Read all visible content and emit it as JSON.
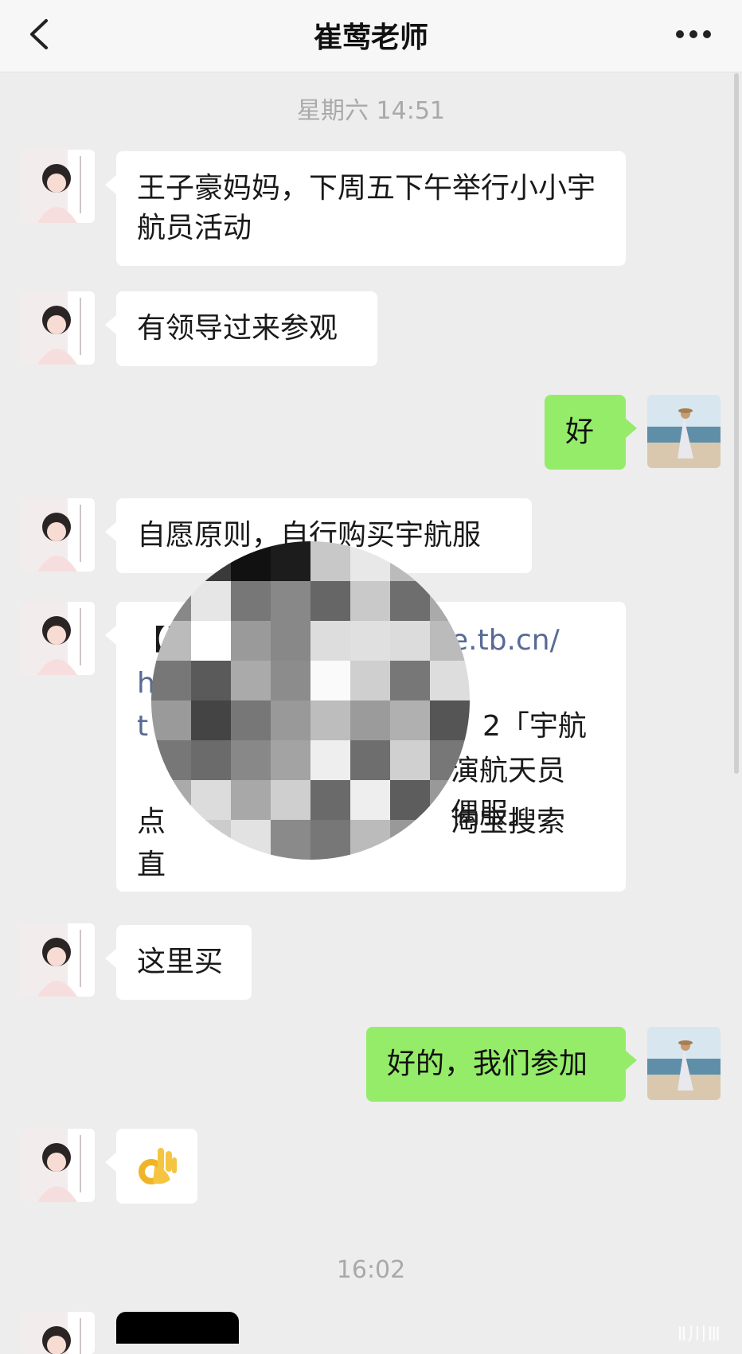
{
  "nav": {
    "title": "崔莺老师"
  },
  "timestamps": [
    "星期六 14:51",
    "16:02"
  ],
  "messages": {
    "m1": "王子豪妈妈，下周五下午举行小小宇航员活动",
    "m2": "有领导过来参观",
    "m3": "好",
    "m4": "自愿原则，自行购买宇航服",
    "m5": {
      "line1": "【淘宝",
      "line1_url": "e.tb.cn/",
      "line2": "h.",
      "line3": "t",
      "line3_tail": "2「宇航",
      "line4_tail": "演航天员",
      "line5_tail": "偶服」",
      "line6_head": "点",
      "line6_tail": "淘宝搜索",
      "line7_head": "直"
    },
    "m6": "这里买",
    "m7": "好的，我们参加",
    "m8": "👌"
  },
  "watermark": "Ⅱ川Ⅲ"
}
